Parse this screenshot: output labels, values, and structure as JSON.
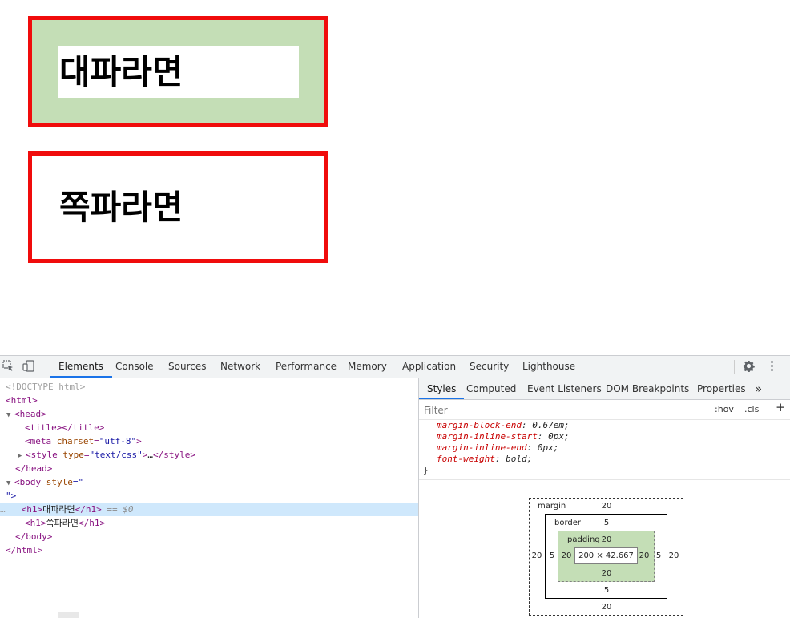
{
  "page": {
    "boxes": [
      {
        "heading": "대파라면"
      },
      {
        "heading": "쪽파라면"
      }
    ],
    "colors": {
      "border": "#f00c0c",
      "highlight": "#c4deb6"
    }
  },
  "devtools": {
    "toolbar": {
      "inspect_icon": "inspect-element-icon",
      "device_icon": "device-toggle-icon",
      "tabs": [
        "Elements",
        "Console",
        "Sources",
        "Network",
        "Performance",
        "Memory",
        "Application",
        "Security",
        "Lighthouse"
      ],
      "active_tab": "Elements",
      "settings_icon": "gear-icon",
      "more_icon": "kebab-menu-icon"
    },
    "elements": {
      "doctype": "<!DOCTYPE html>",
      "html_open": "<html>",
      "head_open": "<head>",
      "title_line": "<title></title>",
      "meta_tag": "meta",
      "meta_attr": "charset",
      "meta_val": "\"utf-8\"",
      "style_tag": "style",
      "style_attr": "type",
      "style_val": "\"text/css\"",
      "style_ellipsis": "…",
      "style_close": "</style>",
      "head_close": "</head>",
      "body_tag": "body",
      "body_attr": "style",
      "body_val_open": "=\"",
      "body_val_close": "\">",
      "h1_first_text": "대파라면",
      "selected_marker": "== $0",
      "h1_second_text": "쪽파라면",
      "body_close": "</body>",
      "html_close": "</html>",
      "dots": "…"
    },
    "side": {
      "tabs": [
        "Styles",
        "Computed",
        "Event Listeners",
        "DOM Breakpoints",
        "Properties"
      ],
      "active_tab": "Styles",
      "more_tabs_label": "»",
      "filter_placeholder": "Filter",
      "hov_label": ":hov",
      "cls_label": ".cls",
      "add_label": "+",
      "css_rules": [
        {
          "prop": "margin-block-end",
          "value": "0.67em;"
        },
        {
          "prop": "margin-inline-start",
          "value": "0px;"
        },
        {
          "prop": "margin-inline-end",
          "value": "0px;"
        },
        {
          "prop": "font-weight",
          "value": "bold;"
        }
      ],
      "closing_brace": "}",
      "box_model": {
        "margin_label": "margin",
        "border_label": "border",
        "padding_label": "padding",
        "margin_top": "20",
        "margin_bottom": "20",
        "margin_left": "20",
        "margin_right": "20",
        "border_top": "5",
        "border_bottom": "5",
        "border_left": "5",
        "border_right": "5",
        "padding_top": "20",
        "padding_bottom": "20",
        "padding_left": "20",
        "padding_right": "20",
        "content_size": "200 × 42.667"
      }
    }
  }
}
